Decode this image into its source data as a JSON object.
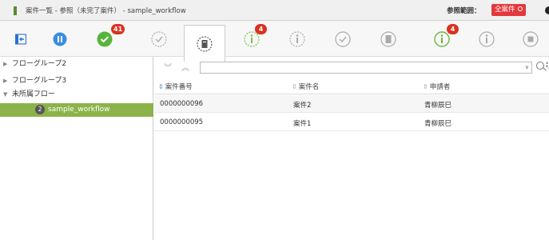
{
  "window": {
    "title": "案件一覧 - 参照（未完了案件） - sample_workflow",
    "scope_label": "参照範囲：",
    "scope_value": "全案件"
  },
  "toolbar": {
    "items": [
      {
        "name": "collapse",
        "icon": "collapse-panel-icon",
        "badge": ""
      },
      {
        "name": "pause",
        "icon": "pause-circle-icon",
        "badge": ""
      },
      {
        "name": "approved",
        "icon": "check-circle-filled-icon",
        "badge": "41"
      },
      {
        "name": "check-dashed",
        "icon": "check-circle-dashed-icon",
        "badge": ""
      },
      {
        "name": "document-dashed",
        "icon": "document-dashed-icon",
        "badge": ""
      },
      {
        "name": "info-dashed-green",
        "icon": "info-circle-dashed-icon",
        "badge": "4"
      },
      {
        "name": "info-dashed",
        "icon": "info-circle-dashed-gray-icon",
        "badge": ""
      },
      {
        "name": "check-outline",
        "icon": "check-circle-outline-icon",
        "badge": ""
      },
      {
        "name": "document-outline",
        "icon": "document-circle-icon",
        "badge": ""
      },
      {
        "name": "info-green",
        "icon": "info-circle-green-icon",
        "badge": "4"
      },
      {
        "name": "info-outline",
        "icon": "info-circle-outline-icon",
        "badge": ""
      },
      {
        "name": "stop-outline",
        "icon": "stop-circle-icon",
        "badge": ""
      }
    ]
  },
  "sidebar": {
    "items": [
      {
        "label": "フローグループ2",
        "arrow": "▶",
        "count": ""
      },
      {
        "label": "フローグループ3",
        "arrow": "▶",
        "count": ""
      },
      {
        "label": "未所属フロー",
        "arrow": "▼",
        "count": ""
      },
      {
        "label": "sample_workflow",
        "arrow": "",
        "count": "2"
      }
    ]
  },
  "filter": {
    "value": ""
  },
  "table": {
    "columns": [
      "案件番号",
      "案件名",
      "申請者"
    ],
    "rows": [
      [
        "0000000096",
        "案件2",
        "青柳辰巳"
      ],
      [
        "0000000095",
        "案件1",
        "青柳辰巳"
      ]
    ]
  },
  "colors": {
    "accent_green": "#8cb34a",
    "badge_red": "#d9331f",
    "scope_red": "#e4393c"
  }
}
